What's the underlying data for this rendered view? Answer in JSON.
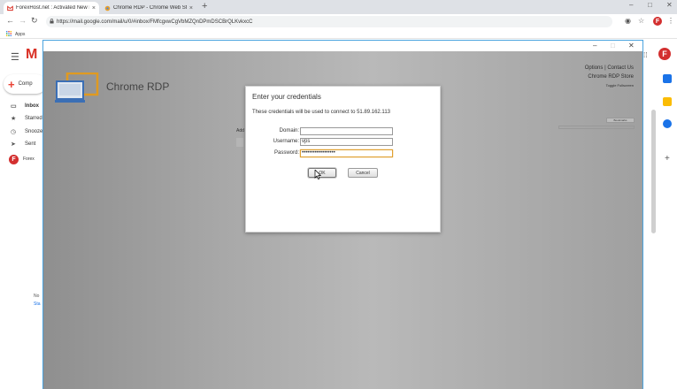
{
  "browser": {
    "tabs": [
      {
        "title": "ForexHost.net : Activated New R",
        "active": true
      },
      {
        "title": "Chrome RDP - Chrome Web Sto",
        "active": false
      }
    ],
    "url": "https://mail.google.com/mail/u/0/#inbox/FMfcgxwCgVbMZQnDPmDSCBrQLKvkxcC",
    "bookmarks_label": "Apps",
    "profile_letter": "F"
  },
  "gmail": {
    "compose_label": "Comp",
    "nav": [
      {
        "label": "Inbox",
        "icon": "inbox-icon"
      },
      {
        "label": "Starred",
        "icon": "star-icon"
      },
      {
        "label": "Snooze",
        "icon": "clock-icon"
      },
      {
        "label": "Sent",
        "icon": "send-icon"
      }
    ],
    "account_label": "Forex",
    "chat_line1": "No",
    "chat_line2": "Sta"
  },
  "rdp": {
    "app_title": "Chrome RDP",
    "links": {
      "options": "Options",
      "separator": "|",
      "contact": "Contact Us",
      "store": "Chrome RDP Store",
      "toggle": "Toggle Fullscreen"
    },
    "address_label": "Add",
    "bookmark_button": "Bookmarks"
  },
  "dialog": {
    "title": "Enter your credentials",
    "message": "These credentials will be used to connect to 51.89.162.113",
    "fields": {
      "domain": {
        "label": "Domain:",
        "value": ""
      },
      "username": {
        "label": "Username:",
        "value": "vps"
      },
      "password": {
        "label": "Password:",
        "value": "••••••••••••••••••"
      }
    },
    "ok_label": "OK",
    "cancel_label": "Cancel"
  },
  "colors": {
    "accent_blue": "#4aa3df",
    "gmail_red": "#d93025",
    "focus_orange": "#e0a030"
  }
}
